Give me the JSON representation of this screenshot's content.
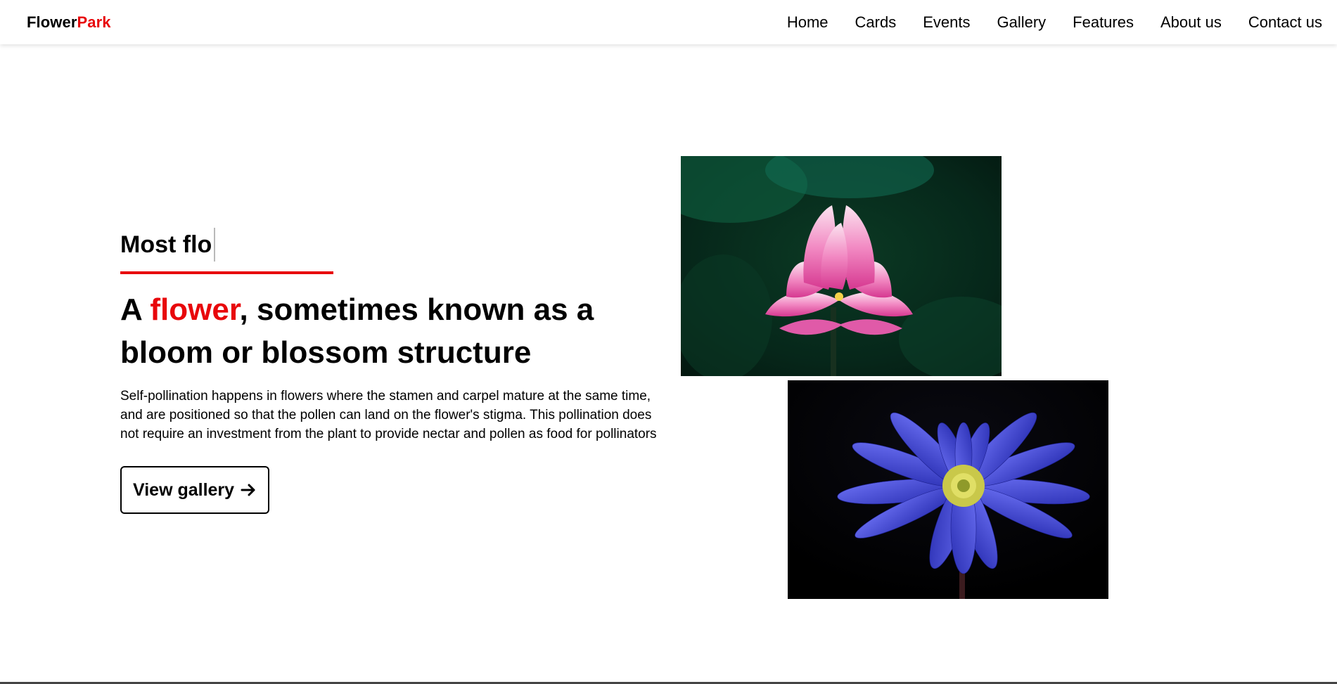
{
  "header": {
    "logo_part1": "Flower",
    "logo_part2": "Park",
    "nav": [
      "Home",
      "Cards",
      "Events",
      "Gallery",
      "Features",
      "About us",
      "Contact us"
    ]
  },
  "hero": {
    "typed_text": "Most flo",
    "headline_pre": "A ",
    "headline_accent": "flower",
    "headline_post": ", sometimes known as a bloom or blossom structure",
    "description": "Self-pollination happens in flowers where the stamen and carpel mature at the same time, and are positioned so that the pollen can land on the flower's stigma. This pollination does not require an investment from the plant to provide nectar and pollen as food for pollinators",
    "button_label": "View gallery"
  },
  "colors": {
    "accent": "#e8070b",
    "text": "#000000",
    "background": "#ffffff"
  },
  "images": [
    "pink-lotus-photo",
    "blue-anemone-photo"
  ]
}
